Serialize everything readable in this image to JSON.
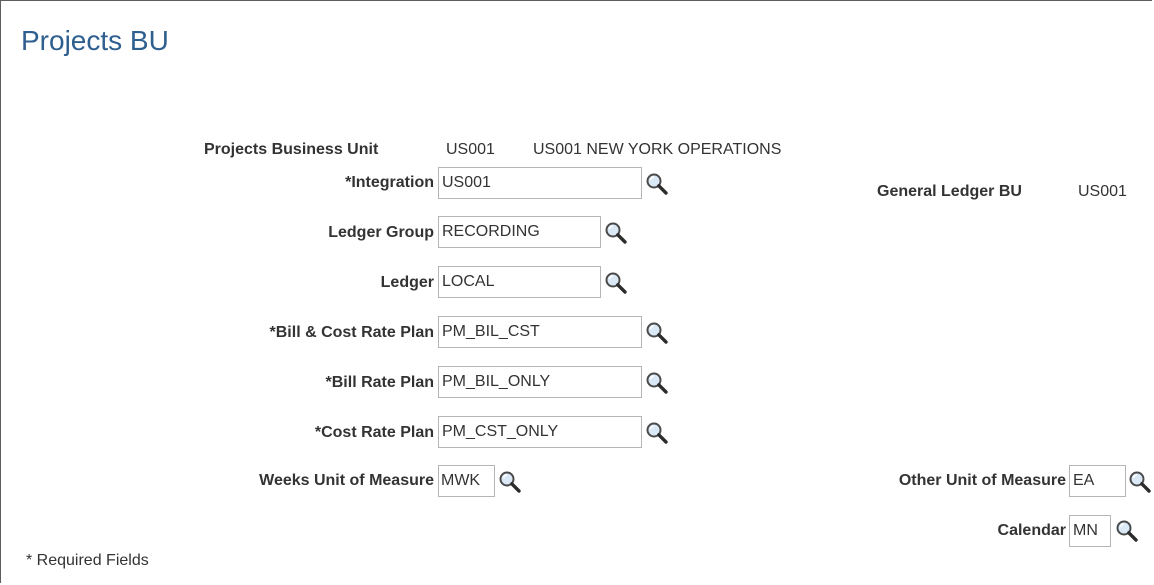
{
  "page": {
    "title": "Projects BU"
  },
  "header": {
    "bu_label": "Projects Business Unit",
    "bu_code": "US001",
    "bu_desc": "US001 NEW YORK OPERATIONS",
    "gl_label": "General Ledger BU",
    "gl_value": "US001"
  },
  "fields": {
    "integration": {
      "label": "*Integration",
      "value": "US001"
    },
    "ledger_group": {
      "label": "Ledger Group",
      "value": "RECORDING"
    },
    "ledger": {
      "label": "Ledger",
      "value": "LOCAL"
    },
    "bill_cost_rate_plan": {
      "label": "*Bill & Cost Rate Plan",
      "value": "PM_BIL_CST"
    },
    "bill_rate_plan": {
      "label": "*Bill Rate Plan",
      "value": "PM_BIL_ONLY"
    },
    "cost_rate_plan": {
      "label": "*Cost Rate Plan",
      "value": "PM_CST_ONLY"
    },
    "weeks_uom": {
      "label": "Weeks Unit of Measure",
      "value": "MWK"
    },
    "other_uom": {
      "label": "Other Unit of Measure",
      "value": "EA"
    },
    "calendar": {
      "label": "Calendar",
      "value": "MN"
    }
  },
  "footer": {
    "required_note": "* Required Fields"
  },
  "icons": {
    "lookup": "lookup-magnifier-icon"
  },
  "colors": {
    "title": "#2f5f8f",
    "text": "#333333",
    "border": "#b5b5b5"
  }
}
